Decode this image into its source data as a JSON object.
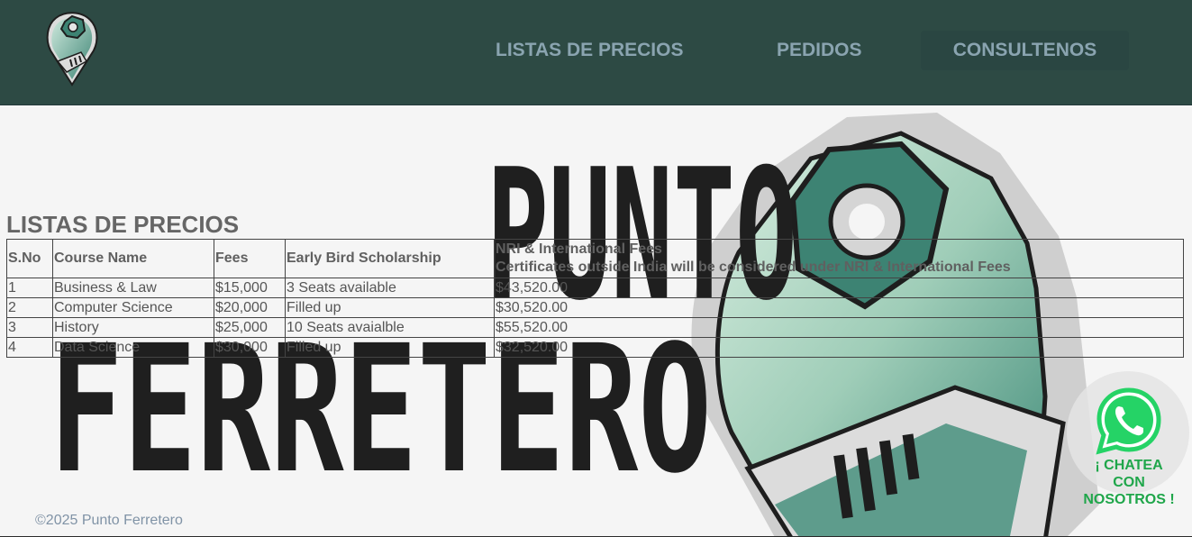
{
  "header": {
    "logo_icon": "wrench-nut-logo-icon",
    "nav": [
      {
        "label": "LISTAS DE PRECIOS"
      },
      {
        "label": "PEDIDOS"
      },
      {
        "label": "CONSULTENOS"
      }
    ]
  },
  "background": {
    "word1": "PUNTO",
    "word2": "FERRETERO",
    "art_icon": "wrench-nut-icon"
  },
  "main": {
    "title": "LISTAS DE PRECIOS",
    "table": {
      "headers": {
        "sno": "S.No",
        "course": "Course Name",
        "fees": "Fees",
        "early": "Early Bird Scholarship",
        "nri_line1": "NRI & International Fees",
        "nri_line2": "Certificates outside India will be considered under NRI & International Fees"
      },
      "rows": [
        {
          "sno": "1",
          "course": "Business & Law",
          "fees": "$15,000",
          "early": "3 Seats available",
          "nri": "$43,520.00"
        },
        {
          "sno": "2",
          "course": "Computer Science",
          "fees": "$20,000",
          "early": "Filled up",
          "nri": "$30,520.00"
        },
        {
          "sno": "3",
          "course": "History",
          "fees": "$25,000",
          "early": "10 Seats avaialble",
          "nri": "$55,520.00"
        },
        {
          "sno": "4",
          "course": "Data Science",
          "fees": "$30,000",
          "early": "Filled up",
          "nri": "$32,520.00"
        }
      ]
    }
  },
  "footer": {
    "copyright": "©2025 Punto Ferretero"
  },
  "whatsapp": {
    "icon": "whatsapp-icon",
    "label": "¡ CHATEA\nCON\nNOSOTROS !",
    "color": "#1fa64a"
  },
  "colors": {
    "header_bg": "#2d4a44",
    "nav_text": "#8aa4b0",
    "accent_green": "#4a8a7c"
  }
}
